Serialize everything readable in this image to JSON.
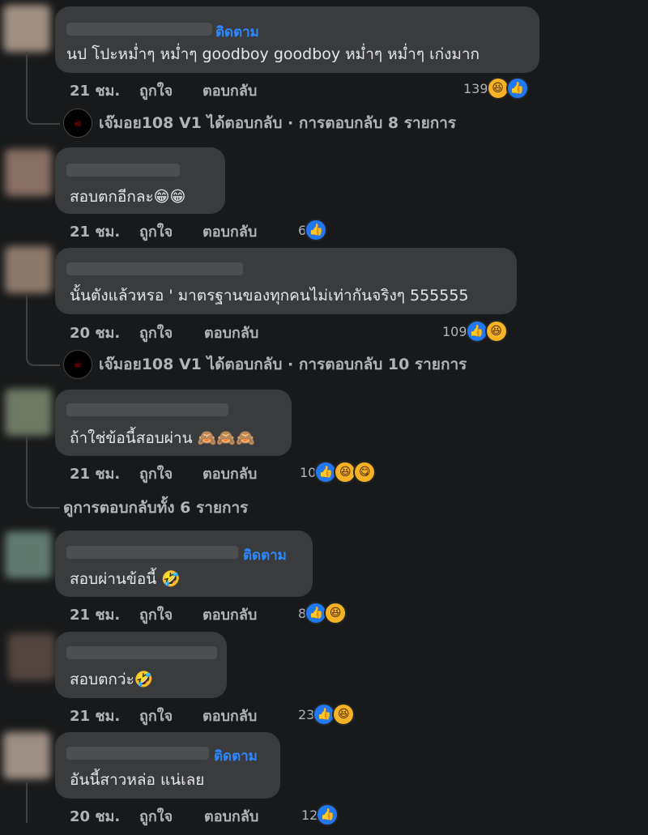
{
  "labels": {
    "like": "ถูกใจ",
    "reply": "ตอบกลับ",
    "follow": "ติดตาม"
  },
  "comments": [
    {
      "text": "นป โปะหม่ำๆ หม่ำๆ goodboy goodboy หม่ำๆ หม่ำๆ เก่งมาก",
      "time": "21 ชม.",
      "reactions": "139",
      "follow": "ติดตาม"
    },
    {
      "text": "สอบตกอีกละ😁😁",
      "time": "21 ชม.",
      "reactions": "6"
    },
    {
      "text": "นั้นตังแล้วหรอ ' มาตรฐานของทุกคนไม่เท่ากันจริงๆ 555555",
      "time": "20 ชม.",
      "reactions": "109"
    },
    {
      "text": "ถ้าใช่ข้อนี้สอบผ่าน 🙈🙈🙈",
      "time": "21 ชม.",
      "reactions": "10"
    },
    {
      "text": "สอบผ่านข้อนี้ 🤣",
      "time": "21 ชม.",
      "reactions": "8",
      "follow": "ติดตาม"
    },
    {
      "text": "สอบตกว่ะ🤣",
      "time": "21 ชม.",
      "reactions": "23"
    },
    {
      "text": "อันนี้สาวหล่อ แน่เลย",
      "time": "20 ชม.",
      "reactions": "12",
      "follow": "ติดตาม"
    }
  ],
  "replies": [
    {
      "text": "เจ๊มอย108 V1 ได้ตอบกลับ · การตอบกลับ 8 รายการ"
    },
    {
      "text": "เจ๊มอย108 V1 ได้ตอบกลับ · การตอบกลับ 10 รายการ"
    },
    {
      "text": "ดูการตอบกลับทั้ง 6 รายการ"
    }
  ],
  "colors": {
    "background": "#18191a",
    "bubble": "#3a3b3c",
    "link": "#2d88ff",
    "like": "#2078f4"
  }
}
